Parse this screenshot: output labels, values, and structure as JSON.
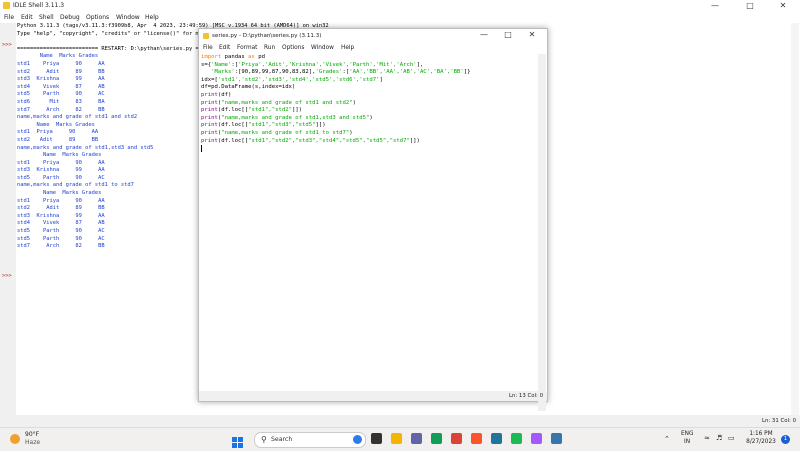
{
  "shell": {
    "title": "IDLE Shell 3.11.3",
    "menu": [
      "File",
      "Edit",
      "Shell",
      "Debug",
      "Options",
      "Window",
      "Help"
    ],
    "prompt": ">>>",
    "lines": [
      {
        "cls": "std",
        "text": "Python 3.11.3 (tags/v3.11.3:f3909b8, Apr  4 2023, 23:49:59) [MSC v.1934 64 bit (AMD64)] on win32"
      },
      {
        "cls": "std",
        "text": "Type \"help\", \"copyright\", \"credits\" or \"license()\" for more information."
      },
      {
        "cls": "std",
        "text": ""
      },
      {
        "cls": "std",
        "text": "========================= RESTART: D:\\pythan\\series.py ========================"
      },
      {
        "cls": "out",
        "text": "       Name  Marks Grades"
      },
      {
        "cls": "out",
        "text": "std1    Priya     90     AA"
      },
      {
        "cls": "out",
        "text": "std2     Adit     89     BB"
      },
      {
        "cls": "out",
        "text": "std3  Krishna     99     AA"
      },
      {
        "cls": "out",
        "text": "std4    Vivek     87     AB"
      },
      {
        "cls": "out",
        "text": "std5    Parth     90     AC"
      },
      {
        "cls": "out",
        "text": "std6      Mit     83     BA"
      },
      {
        "cls": "out",
        "text": "std7     Arch     82     BB"
      },
      {
        "cls": "out",
        "text": "name,marks and grade of std1 and std2"
      },
      {
        "cls": "out",
        "text": "      Name  Marks Grades"
      },
      {
        "cls": "out",
        "text": "std1  Priya     90     AA"
      },
      {
        "cls": "out",
        "text": "std2   Adit     89     BB"
      },
      {
        "cls": "out",
        "text": "name,marks and grade of std1,std3 and std5"
      },
      {
        "cls": "out",
        "text": "        Name  Marks Grades"
      },
      {
        "cls": "out",
        "text": "std1    Priya     90     AA"
      },
      {
        "cls": "out",
        "text": "std3  Krishna     99     AA"
      },
      {
        "cls": "out",
        "text": "std5    Parth     90     AC"
      },
      {
        "cls": "out",
        "text": "name,marks and grade of std1 to std7"
      },
      {
        "cls": "out",
        "text": "        Name  Marks Grades"
      },
      {
        "cls": "out",
        "text": "std1    Priya     90     AA"
      },
      {
        "cls": "out",
        "text": "std2     Adit     89     BB"
      },
      {
        "cls": "out",
        "text": "std3  Krishna     99     AA"
      },
      {
        "cls": "out",
        "text": "std4    Vivek     87     AB"
      },
      {
        "cls": "out",
        "text": "std5    Parth     90     AC"
      },
      {
        "cls": "out",
        "text": "std5    Parth     90     AC"
      },
      {
        "cls": "out",
        "text": "std7     Arch     82     BB"
      }
    ],
    "status": "Ln: 31  Col: 0"
  },
  "editor": {
    "title": "series.py - D:\\pythan\\series.py (3.11.3)",
    "menu": [
      "File",
      "Edit",
      "Format",
      "Run",
      "Options",
      "Window",
      "Help"
    ],
    "code": [
      [
        {
          "c": "kw",
          "t": "import"
        },
        {
          "c": "plain",
          "t": " pandas "
        },
        {
          "c": "kw",
          "t": "as"
        },
        {
          "c": "plain",
          "t": " pd"
        }
      ],
      [
        {
          "c": "plain",
          "t": "s={"
        },
        {
          "c": "str",
          "t": "'Name'"
        },
        {
          "c": "plain",
          "t": ":["
        },
        {
          "c": "str",
          "t": "'Priya','Adit','Krishna','Vivek','Parth','Mit','Arch'"
        },
        {
          "c": "plain",
          "t": "],"
        }
      ],
      [
        {
          "c": "plain",
          "t": "   "
        },
        {
          "c": "str",
          "t": "'Marks'"
        },
        {
          "c": "plain",
          "t": ":[90,89,99,87,90,83,82],"
        },
        {
          "c": "str",
          "t": "'Grades'"
        },
        {
          "c": "plain",
          "t": ":["
        },
        {
          "c": "str",
          "t": "'AA','BB','AA','AB','AC','BA','BB'"
        },
        {
          "c": "plain",
          "t": "]}"
        }
      ],
      [
        {
          "c": "plain",
          "t": "idx=["
        },
        {
          "c": "str",
          "t": "'std1','std2','std3','std4','std5','std6','std7'"
        },
        {
          "c": "plain",
          "t": "]"
        }
      ],
      [
        {
          "c": "plain",
          "t": "df=pd.DataFrame(s,index=idx)"
        }
      ],
      [
        {
          "c": "bi",
          "t": "print"
        },
        {
          "c": "plain",
          "t": "(df)"
        }
      ],
      [
        {
          "c": "bi",
          "t": "print"
        },
        {
          "c": "plain",
          "t": "("
        },
        {
          "c": "str",
          "t": "\"name,marks and grade of std1 and std2\""
        },
        {
          "c": "plain",
          "t": ")"
        }
      ],
      [
        {
          "c": "bi",
          "t": "print"
        },
        {
          "c": "plain",
          "t": "(df.loc[["
        },
        {
          "c": "str",
          "t": "\"std1\",\"std2\""
        },
        {
          "c": "plain",
          "t": "]])"
        }
      ],
      [
        {
          "c": "bi",
          "t": "print"
        },
        {
          "c": "plain",
          "t": "("
        },
        {
          "c": "str",
          "t": "\"name,marks and grade of std1,std3 and std5\""
        },
        {
          "c": "plain",
          "t": ")"
        }
      ],
      [
        {
          "c": "bi",
          "t": "print"
        },
        {
          "c": "plain",
          "t": "(df.loc[["
        },
        {
          "c": "str",
          "t": "\"std1\",\"std3\",\"std5\""
        },
        {
          "c": "plain",
          "t": "]])"
        }
      ],
      [
        {
          "c": "bi",
          "t": "print"
        },
        {
          "c": "plain",
          "t": "("
        },
        {
          "c": "str",
          "t": "\"name,marks and grade of std1 to std7\""
        },
        {
          "c": "plain",
          "t": ")"
        }
      ],
      [
        {
          "c": "bi",
          "t": "print"
        },
        {
          "c": "plain",
          "t": "(df.loc[["
        },
        {
          "c": "str",
          "t": "\"std1\",\"std2\",\"std3\",\"std4\",\"std5\",\"std5\",\"std7\""
        },
        {
          "c": "plain",
          "t": "]])"
        }
      ]
    ],
    "status": "Ln: 13  Col: 0"
  },
  "taskbar": {
    "weather_temp": "90°F",
    "weather_desc": "Haze",
    "search_label": "Search",
    "lang_top": "ENG",
    "lang_bottom": "IN",
    "time": "1:16 PM",
    "date": "8/27/2023",
    "notif_count": "1",
    "icons": [
      {
        "name": "start-icon",
        "color": "#1a73e8"
      },
      {
        "name": "bing-icon",
        "color": "#2b7de9"
      },
      {
        "name": "task-view-icon",
        "color": "#333333"
      },
      {
        "name": "file-explorer-icon",
        "color": "#f4b400"
      },
      {
        "name": "chat-icon",
        "color": "#6264a7"
      },
      {
        "name": "edge-icon",
        "color": "#0f9d58"
      },
      {
        "name": "chrome-icon",
        "color": "#db4437"
      },
      {
        "name": "brave-icon",
        "color": "#fb542b"
      },
      {
        "name": "wordpress-icon",
        "color": "#21759b"
      },
      {
        "name": "spotify-icon",
        "color": "#1db954"
      },
      {
        "name": "photos-icon",
        "color": "#a259ff"
      },
      {
        "name": "idle-icon",
        "color": "#3776ab"
      }
    ]
  }
}
